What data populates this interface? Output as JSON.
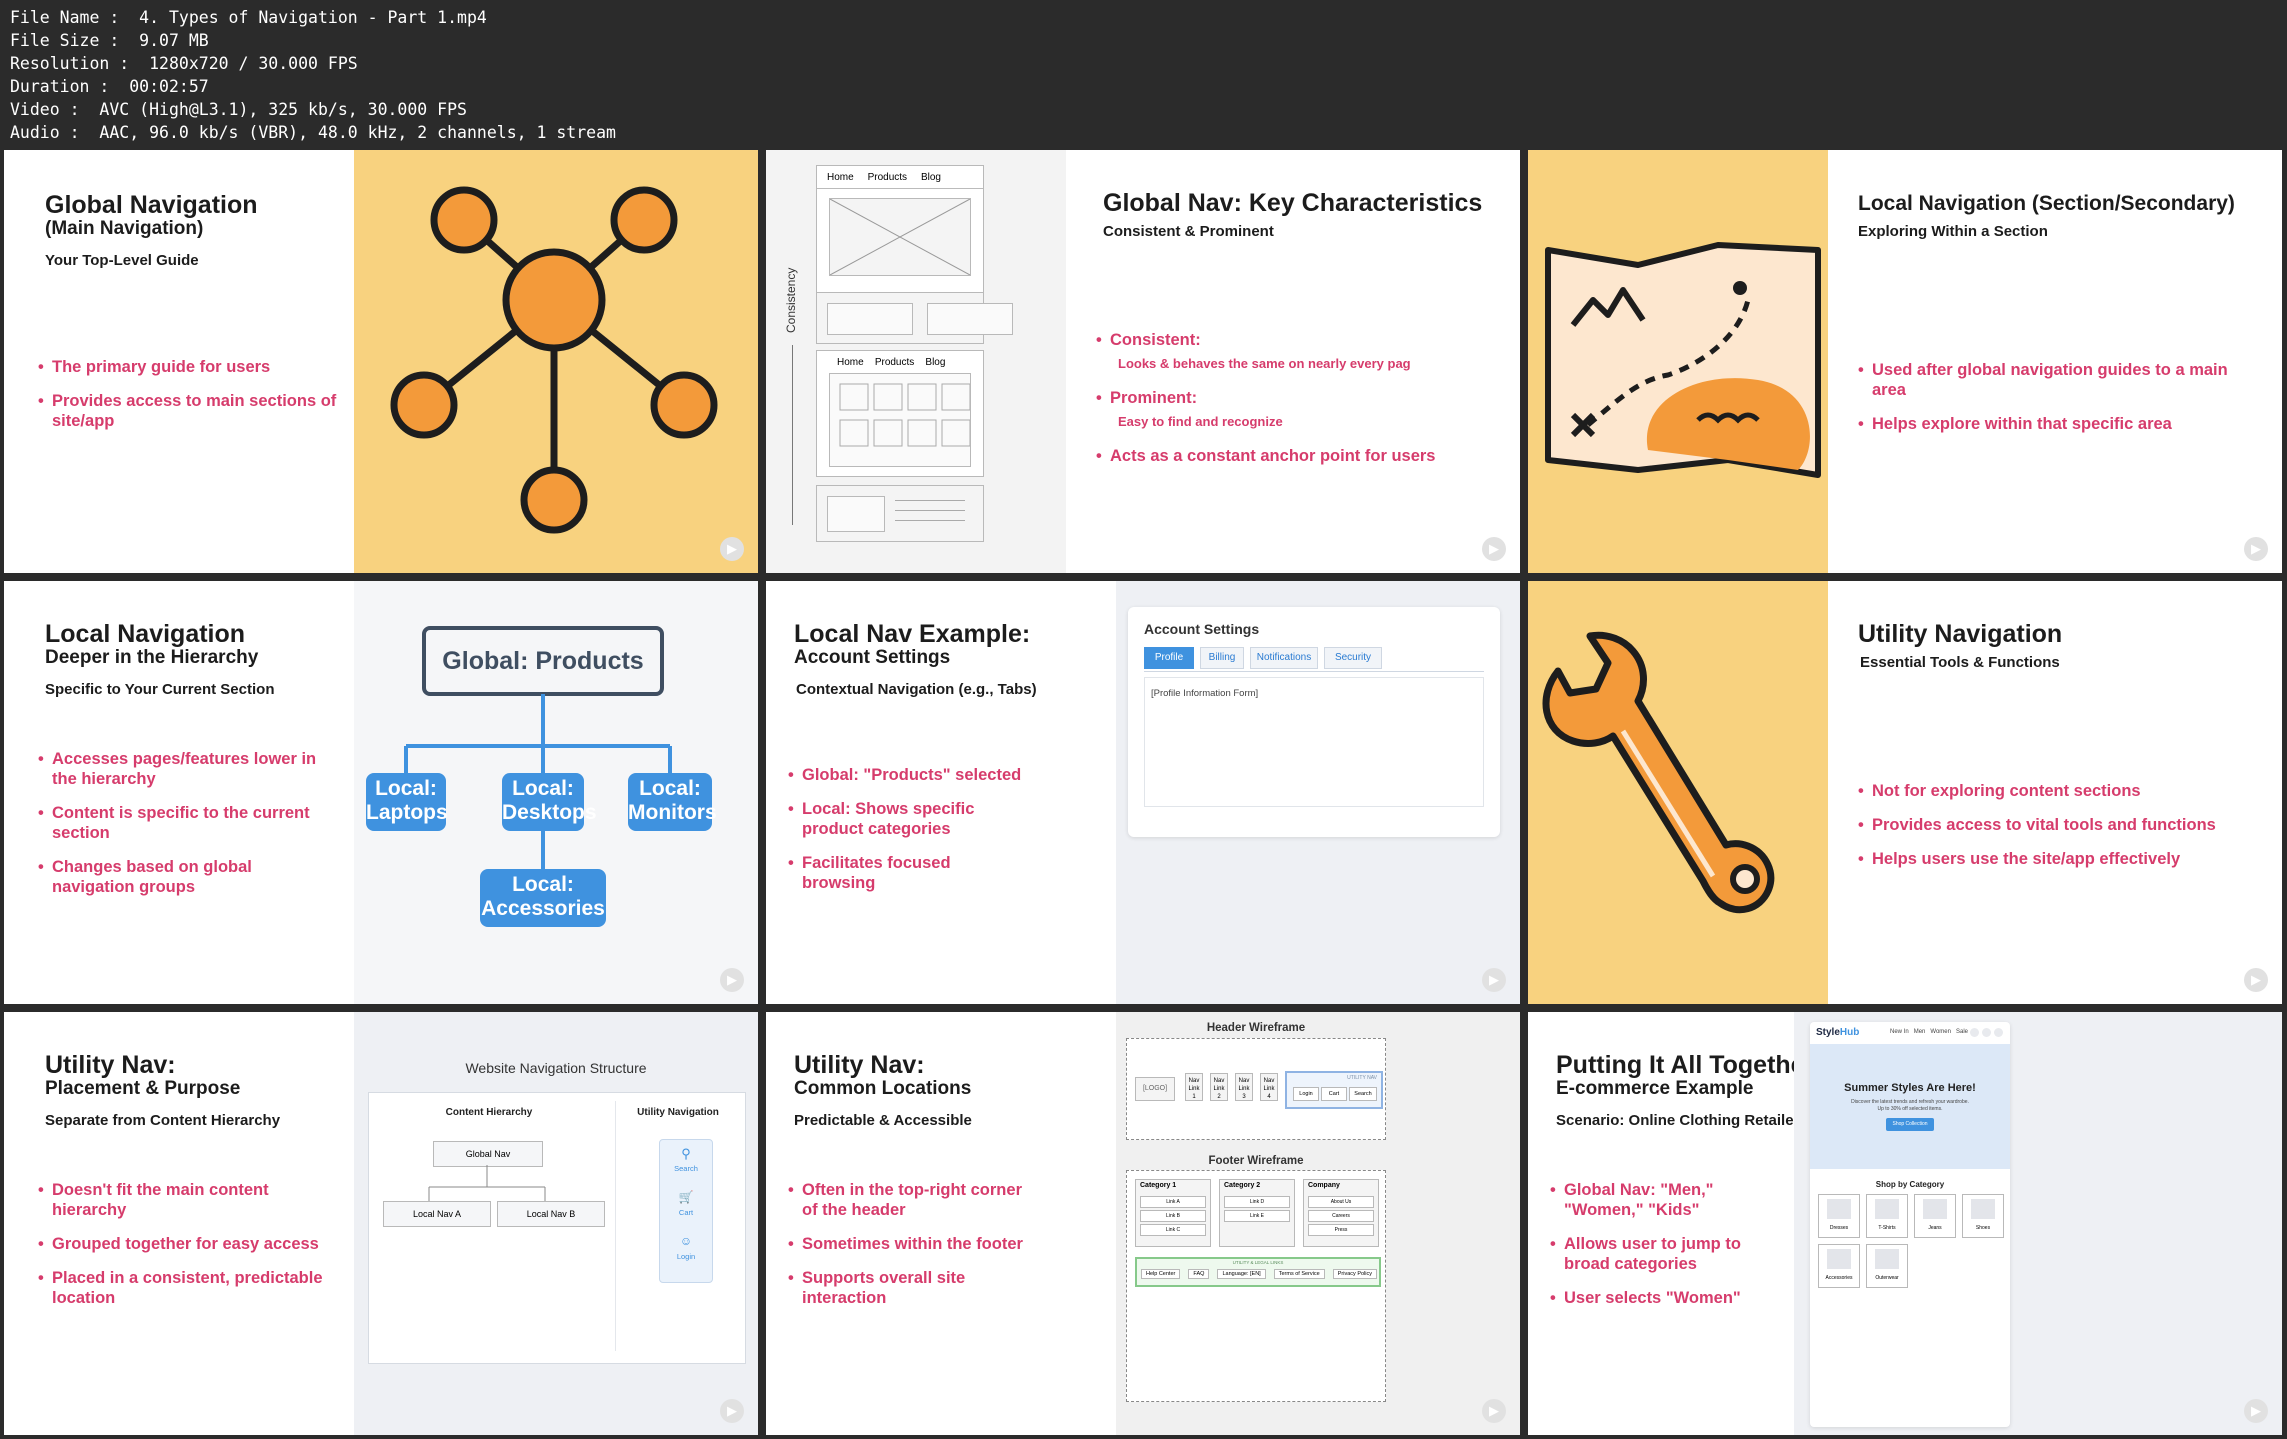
{
  "file_info": [
    {
      "label": "File Name",
      "value": "4. Types of Navigation - Part 1.mp4"
    },
    {
      "label": "File Size",
      "value": "9.07 MB"
    },
    {
      "label": "Resolution",
      "value": "1280x720 / 30.000 FPS"
    },
    {
      "label": "Duration",
      "value": "00:02:57"
    },
    {
      "label": "Video",
      "value": "AVC (High@L3.1), 325 kb/s, 30.000 FPS"
    },
    {
      "label": "Audio",
      "value": "AAC, 96.0 kb/s (VBR), 48.0 kHz, 2 channels, 1 stream"
    }
  ],
  "slides": {
    "s1": {
      "title": "Global Navigation",
      "subtitle": "(Main Navigation)",
      "tag": "Your Top-Level Guide",
      "bullets": [
        "The primary guide for users",
        "Provides access to main sections of site/app"
      ]
    },
    "s2": {
      "title": "Global Nav: Key Characteristics",
      "tag": "Consistent & Prominent",
      "b1": "Consistent:",
      "b1_sub": "Looks & behaves the same on nearly every pag",
      "b2": "Prominent:",
      "b2_sub": "Easy to find and recognize",
      "b3": "Acts as a constant anchor point for users",
      "wire_nav": [
        "Home",
        "Products",
        "Blog"
      ],
      "wire_side": "Consistency"
    },
    "s3": {
      "title": "Local Navigation (Section/Secondary)",
      "tag": "Exploring Within a Section",
      "bullets": [
        "Used after global navigation guides to a main area",
        "Helps explore within that specific area"
      ]
    },
    "s4": {
      "title": "Local Navigation",
      "subtitle": "Deeper in the Hierarchy",
      "tag": "Specific to Your Current Section",
      "bullets": [
        "Accesses pages/features lower in the hierarchy",
        "Content is specific to the current section",
        "Changes based on global navigation groups"
      ],
      "root": "Global: Products",
      "n1a": "Local:",
      "n1b": "Laptops",
      "n2a": "Local:",
      "n2b": "Desktops",
      "n3a": "Local:",
      "n3b": "Monitors",
      "n4a": "Local:",
      "n4b": "Accessories"
    },
    "s5": {
      "title": "Local Nav Example:",
      "subtitle": "Account Settings",
      "tag": "Contextual Navigation (e.g., Tabs)",
      "bullets": [
        "Global: \"Products\" selected",
        "Local: Shows specific product categories",
        "Facilitates focused browsing"
      ],
      "panel_title": "Account Settings",
      "tabs": [
        "Profile",
        "Billing",
        "Notifications",
        "Security"
      ],
      "form_label": "[Profile Information Form]"
    },
    "s6": {
      "title": "Utility Navigation",
      "tag": "Essential Tools & Functions",
      "bullets": [
        "Not for exploring content sections",
        "Provides access to vital tools and functions",
        "Helps users use the site/app effectively"
      ]
    },
    "s7": {
      "title": "Utility Nav:",
      "subtitle": "Placement & Purpose",
      "tag": "Separate from Content Hierarchy",
      "bullets": [
        "Doesn't fit the main content hierarchy",
        "Grouped together for easy access",
        "Placed in a consistent, predictable location"
      ],
      "diagram_title": "Website Navigation Structure",
      "col1": "Content Hierarchy",
      "col2": "Utility Navigation",
      "gnav": "Global Nav",
      "lnav_a": "Local Nav A",
      "lnav_b": "Local Nav B",
      "u1": "Search",
      "u2": "Cart",
      "u3": "Login"
    },
    "s8": {
      "title": "Utility Nav:",
      "subtitle": "Common Locations",
      "tag": "Predictable & Accessible",
      "bullets": [
        "Often in the top-right corner of the header",
        "Sometimes within the footer",
        "Supports overall site interaction"
      ],
      "header_wire": "Header Wireframe",
      "logo": "[LOGO]",
      "navlink": "Nav Link",
      "utility_nav": "UTILITY NAV",
      "u_items": [
        "Login",
        "Cart",
        "Search"
      ],
      "footer_wire": "Footer Wireframe",
      "cat1": "Category 1",
      "cat2": "Category 2",
      "company": "Company",
      "cat1_links": [
        "Link A",
        "Link B",
        "Link C"
      ],
      "cat2_links": [
        "Link D",
        "Link E"
      ],
      "company_links": [
        "About Us",
        "Careers",
        "Press"
      ],
      "legal_title": "UTILITY & LEGAL LINKS",
      "legal": [
        "Help Center",
        "FAQ",
        "Language: [EN]",
        "Terms of Service",
        "Privacy Policy"
      ]
    },
    "s9": {
      "title": "Putting It All Together:",
      "subtitle": "E-commerce Example",
      "tag": "Scenario: Online Clothing Retailer",
      "bullets": [
        "Global Nav: \"Men,\" \"Women,\" \"Kids\"",
        "Allows user to jump to broad categories",
        "User selects \"Women\""
      ],
      "brand_a": "Style",
      "brand_b": "Hub",
      "nav": [
        "New In",
        "Men",
        "Women",
        "Sale"
      ],
      "hero_title": "Summer Styles Are Here!",
      "hero_text": "Discover the latest trends and refresh your wardrobe.",
      "hero_text2": "Up to 30% off selected items.",
      "hero_btn": "Shop Collection",
      "shop_by": "Shop by Category",
      "cats": [
        "Dresses",
        "T-Shirts",
        "Jeans",
        "Shoes",
        "Accessories",
        "Outerwear"
      ]
    }
  }
}
